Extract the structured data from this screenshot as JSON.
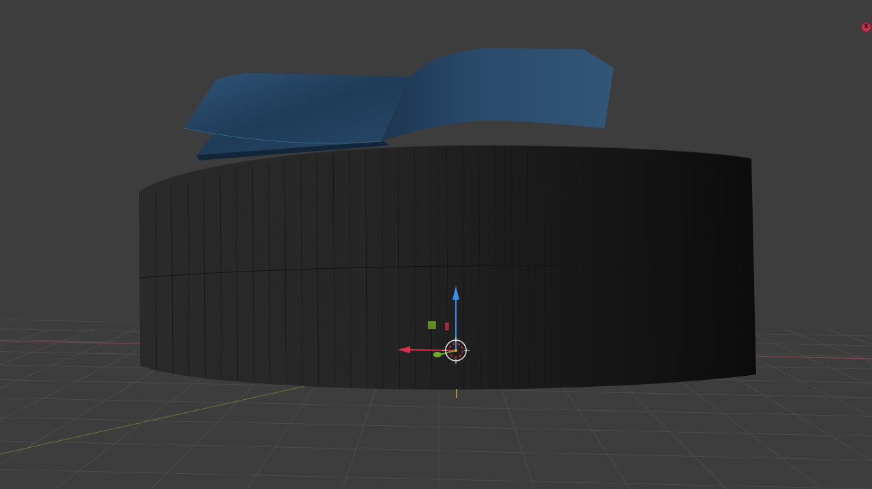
{
  "viewport": {
    "close_button_label": "X"
  },
  "colors": {
    "background": "#3d3d3d",
    "grid_line": "#4a4a4a",
    "x_axis_line": "#7b4a4f",
    "y_axis_line": "#5f6d3a",
    "cylinder_body": "#1c1c1c",
    "surface_mesh": "#2a4a68",
    "gizmo_z_axis": "#3b8ee8",
    "gizmo_x_axis": "#d9304b",
    "gizmo_y_axis": "#6ea72a",
    "origin_marker": "#e8a03b"
  },
  "icons": {
    "close": "x-icon",
    "cursor": "3d-cursor-icon",
    "gizmo": "transform-gizmo-icon"
  }
}
